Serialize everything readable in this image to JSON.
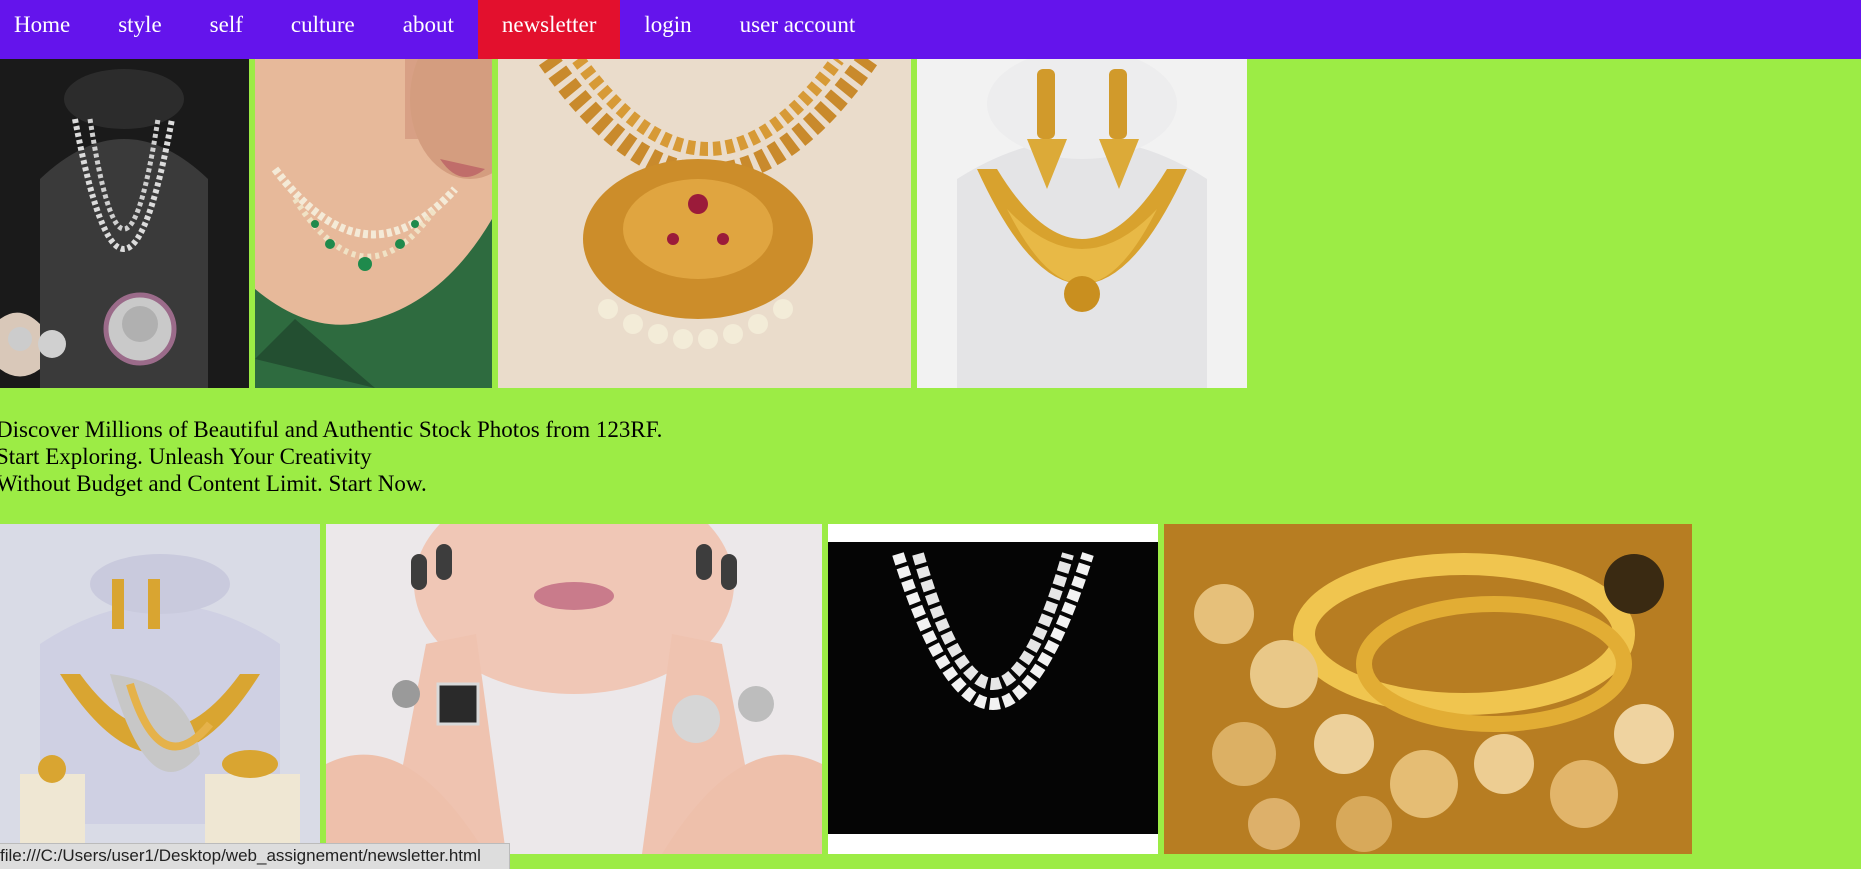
{
  "nav": {
    "items": [
      {
        "label": "Home"
      },
      {
        "label": "style"
      },
      {
        "label": "self"
      },
      {
        "label": "culture"
      },
      {
        "label": "about"
      },
      {
        "label": "newsletter"
      },
      {
        "label": "login"
      },
      {
        "label": "user account"
      }
    ],
    "active_item": "newsletter",
    "colors": {
      "bar": "#6414EC",
      "active": "#E3102D",
      "text": "#FFFFFF"
    }
  },
  "page": {
    "background": "#9CEC45"
  },
  "caption": {
    "line1": "Discover Millions of Beautiful and Authentic Stock Photos from 123RF.",
    "line2": "Start Exploring. Unleash Your Creativity",
    "line3": "Without Budget and Content Limit. Start Now."
  },
  "status_bar": {
    "url": "file:///C:/Users/user1/Desktop/web_assignement/newsletter.html"
  },
  "images": {
    "row1": [
      {
        "subject": "silver necklace on black bust"
      },
      {
        "subject": "woman wearing diamond necklace"
      },
      {
        "subject": "gold pendant necklace on cloth"
      },
      {
        "subject": "gold necklace and earrings set"
      }
    ],
    "row2": [
      {
        "subject": "gold necklace set on white bust"
      },
      {
        "subject": "woman with rings on fingers"
      },
      {
        "subject": "double strand pearl necklace"
      },
      {
        "subject": "gold jewelry and pearls closeup"
      }
    ]
  }
}
